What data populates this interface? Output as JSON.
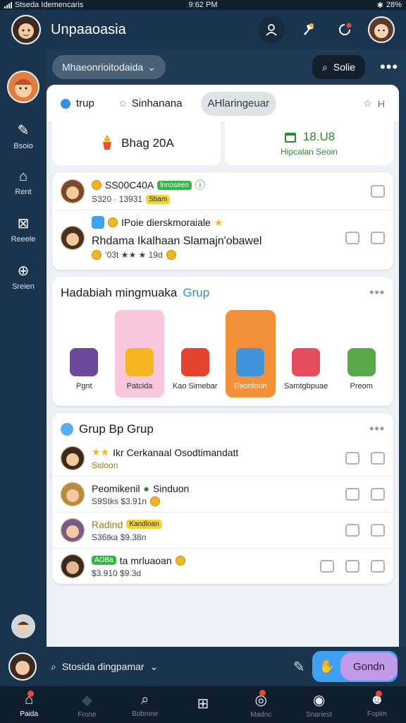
{
  "status_bar": {
    "carrier": "Stseda Idemencaris",
    "time": "9:62 PM",
    "battery": "28%"
  },
  "header": {
    "title": "Unpaaoasia"
  },
  "toolbar": {
    "dropdown": "Mhaeonrioitodaida",
    "solid_button": "Solie"
  },
  "sidebar": {
    "items": [
      {
        "label": "Bsoio",
        "icon": "edit-icon"
      },
      {
        "label": "Rent",
        "icon": "home-icon"
      },
      {
        "label": "Reeele",
        "icon": "gift-icon"
      },
      {
        "label": "Sreien",
        "icon": "lock-icon"
      }
    ]
  },
  "tabs": [
    {
      "label": "trup"
    },
    {
      "label": "Sinhanana"
    },
    {
      "label": "AHlaringeuar"
    },
    {
      "label": "H"
    }
  ],
  "stats": {
    "left": "Bhag 20A",
    "right_value": "18.U8",
    "right_sub": "Hipcalan Seoin"
  },
  "activity": [
    {
      "title": "SS00C40A",
      "badge1": "lnnoseen",
      "badge2": "Sbam",
      "sub": "S320 · 13931"
    },
    {
      "title": "IPoie dierskmoraiale",
      "sub": "Rhdama Ikalhaan Slamajn'obawel",
      "meta": "ʻ03t ★★ ★ 19d"
    }
  ],
  "gifts_card": {
    "title": "Hadabiah mingmuaka",
    "accent": "Grup",
    "items": [
      {
        "label": "Pgnt"
      },
      {
        "label": "Patcida"
      },
      {
        "label": "Kao Simebar"
      },
      {
        "label": "Eeonloun"
      },
      {
        "label": "Samtgbpuae"
      },
      {
        "label": "Preom"
      }
    ]
  },
  "group_card": {
    "title": "Grup Bp Grup",
    "rows": [
      {
        "title": "Ikr Cerkanaal Osodtimandatt",
        "sub": "Sidoon"
      },
      {
        "title": "Peomikenil",
        "badge": "Sinduon",
        "sub": "S9Stks $3.91n"
      },
      {
        "title": "Radind",
        "badge": "Kandloan",
        "sub": "S36tka $9.38n"
      },
      {
        "title": "ta mrluaoan",
        "badge": "AOBa",
        "sub": "$3.910 $9.3d"
      }
    ]
  },
  "composer": {
    "placeholder": "Stosida dingpamar",
    "send": "Gondn"
  },
  "bottom_nav": [
    {
      "label": "Paida",
      "icon": "home-icon"
    },
    {
      "label": "Frone",
      "icon": "diamond-icon"
    },
    {
      "label": "Bobmne",
      "icon": "search-icon"
    },
    {
      "label": "",
      "icon": "grid-icon"
    },
    {
      "label": "Madnc",
      "icon": "bell-icon"
    },
    {
      "label": "Snariest",
      "icon": "circle-icon"
    },
    {
      "label": "Fopim",
      "icon": "profile-icon"
    }
  ],
  "colors": {
    "background": "#1f3a55",
    "accent_blue": "#2f89df",
    "green": "#2a8c2a",
    "send_purple": "#c19be8"
  }
}
